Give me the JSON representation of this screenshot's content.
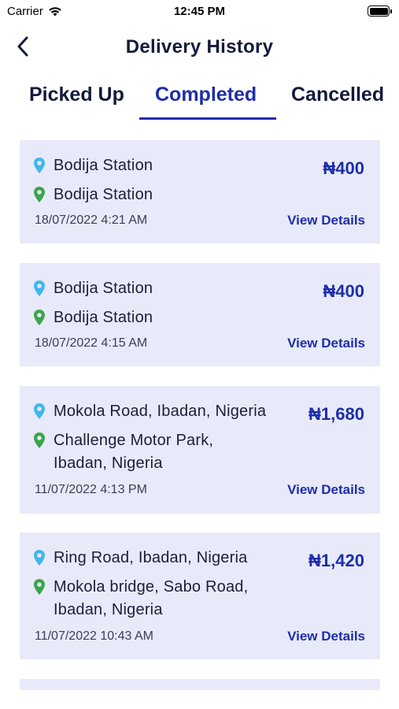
{
  "status_bar": {
    "carrier": "Carrier",
    "time": "12:45 PM"
  },
  "header": {
    "title": "Delivery History"
  },
  "tabs": [
    {
      "label": "Picked Up",
      "active": false
    },
    {
      "label": "Completed",
      "active": true
    },
    {
      "label": "Cancelled",
      "active": false
    }
  ],
  "colors": {
    "accent": "#1d2eaa",
    "card_bg": "#e8eaf9",
    "pickup_pin": "#3fb7f0",
    "dropoff_pin": "#3aa54a"
  },
  "icons": {
    "back": "chevron-left-icon",
    "pickup": "map-pin-icon",
    "dropoff": "map-pin-icon"
  },
  "deliveries": [
    {
      "pickup": "Bodija Station",
      "dropoff": "Bodija Station",
      "date": "18/07/2022 4:21 AM",
      "price": "₦400",
      "action": "View Details"
    },
    {
      "pickup": "Bodija Station",
      "dropoff": "Bodija Station",
      "date": "18/07/2022 4:15 AM",
      "price": "₦400",
      "action": "View Details"
    },
    {
      "pickup": "Mokola Road, Ibadan, Nigeria",
      "dropoff_line1": "Challenge Motor Park,",
      "dropoff_line2": "Ibadan, Nigeria",
      "date": "11/07/2022 4:13 PM",
      "price": "₦1,680",
      "action": "View Details"
    },
    {
      "pickup": "Ring Road, Ibadan, Nigeria",
      "dropoff_line1": "Mokola bridge, Sabo Road,",
      "dropoff_line2": "Ibadan, Nigeria",
      "date": "11/07/2022 10:43 AM",
      "price": "₦1,420",
      "action": "View Details"
    }
  ]
}
